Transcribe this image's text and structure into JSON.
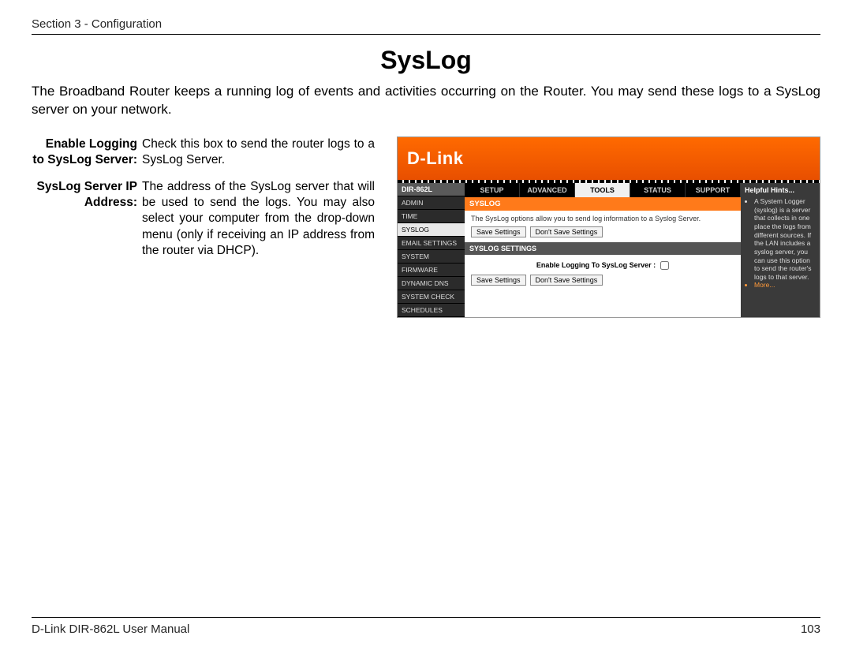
{
  "header": {
    "section_label": "Section 3 - Configuration"
  },
  "page": {
    "title": "SysLog",
    "intro": "The Broadband Router keeps a running log of events and activities occurring on the Router. You may send these logs to a SysLog server on your network."
  },
  "definitions": [
    {
      "term": "Enable Logging to SysLog Server:",
      "desc": "Check this box to send the router logs to a SysLog Server."
    },
    {
      "term": "SysLog Server IP Address:",
      "desc": "The address of the SysLog server that will be used to send the logs. You may also select your computer from the drop-down menu (only if receiving an IP address from the router via DHCP)."
    }
  ],
  "router": {
    "brand": "D-Link",
    "model": "DIR-862L",
    "tabs": [
      "SETUP",
      "ADVANCED",
      "TOOLS",
      "STATUS",
      "SUPPORT"
    ],
    "active_tab": "TOOLS",
    "side_items": [
      "ADMIN",
      "TIME",
      "SYSLOG",
      "EMAIL SETTINGS",
      "SYSTEM",
      "FIRMWARE",
      "DYNAMIC DNS",
      "SYSTEM CHECK",
      "SCHEDULES"
    ],
    "active_side": "SYSLOG",
    "section_title": "SYSLOG",
    "section_text": "The SysLog options allow you to send log information to a Syslog Server.",
    "save_btn": "Save Settings",
    "dont_save_btn": "Don't Save Settings",
    "settings_bar": "SYSLOG SETTINGS",
    "form_label": "Enable Logging To SysLog Server :",
    "hints_title": "Helpful Hints...",
    "hints_text": "A System Logger (syslog) is a server that collects in one place the logs from different sources. If the LAN includes a syslog server, you can use this option to send the router's logs to that server.",
    "hints_more": "More..."
  },
  "footer": {
    "manual": "D-Link DIR-862L User Manual",
    "page_no": "103"
  }
}
